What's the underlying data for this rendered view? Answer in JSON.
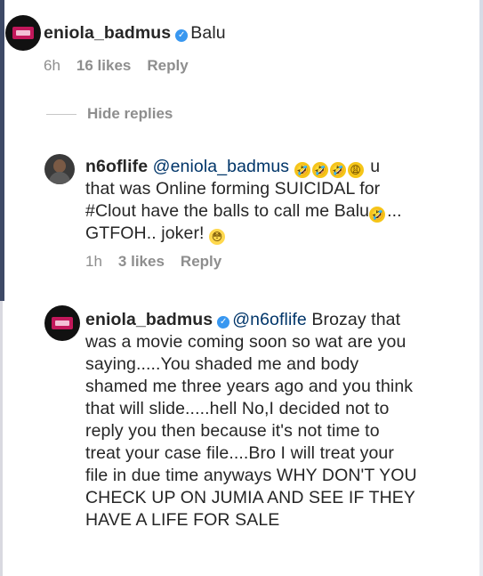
{
  "comments": [
    {
      "username": "eniola_badmus",
      "text": "Balu",
      "time": "6h",
      "likes": "16 likes",
      "reply": "Reply"
    }
  ],
  "replies_toggle": "Hide replies",
  "replies": [
    {
      "username": "n6oflife",
      "mention": "@eniola_badmus",
      "line1_tail": "u",
      "line2": "that was Online forming SUICIDAL for",
      "line3": "#Clout have the balls to call me Balu",
      "line3_tail": "...",
      "line4": "GTFOH.. joker!",
      "time": "1h",
      "likes": "3 likes",
      "reply": "Reply"
    },
    {
      "username": "eniola_badmus",
      "mention": "@n6oflife",
      "line1_tail": "Brozay that",
      "lines": [
        "was a movie coming soon so wat are you",
        "saying.....You shaded me  and body",
        "shamed me three years ago and you think",
        "that will slide.....hell No,I decided not to",
        "reply you then because it's not time to",
        "treat your case file....Bro I will treat your",
        "file in due time anyways WHY DON'T YOU",
        "CHECK UP ON JUMIA AND SEE IF THEY",
        "HAVE A LIFE FOR SALE"
      ]
    }
  ],
  "icons": {
    "verified": "verified-badge-icon",
    "laugh": "rolling-on-floor-laughing-emoji",
    "weary": "weary-face-emoji",
    "flushed": "flushed-face-emoji"
  },
  "colors": {
    "verified_blue": "#3897f0",
    "meta_gray": "#8e8e8e",
    "brand_pink": "#c2185b"
  }
}
